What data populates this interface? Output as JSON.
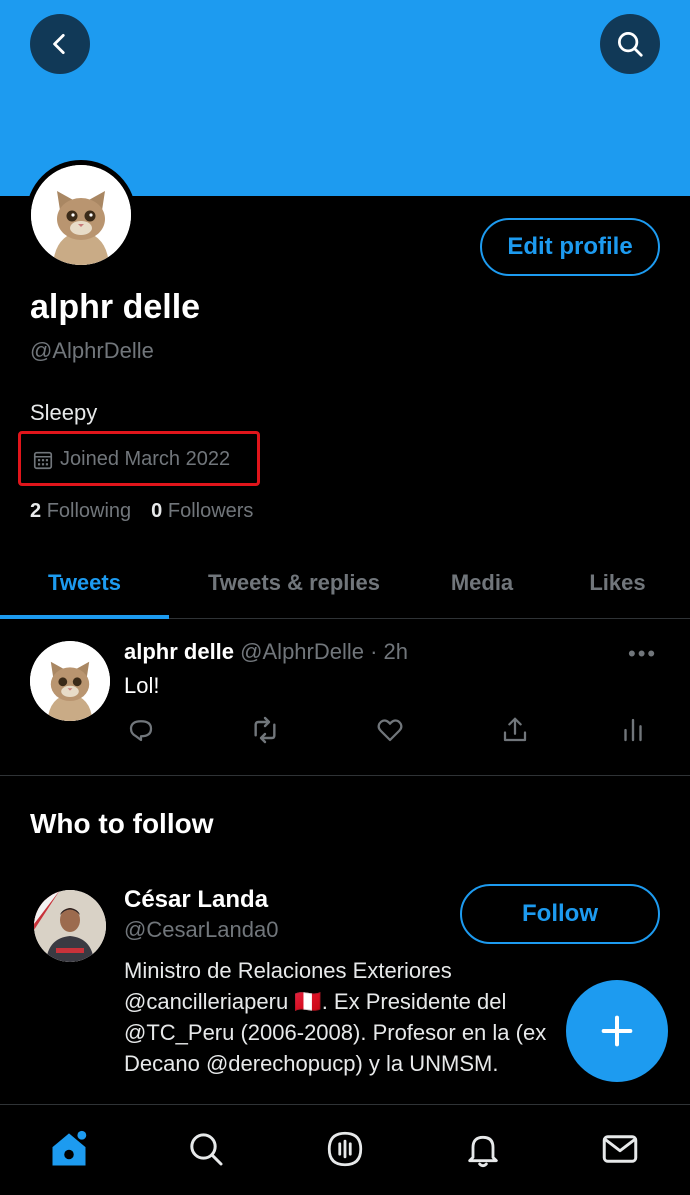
{
  "profile": {
    "name": "alphr delle",
    "handle": "@AlphrDelle",
    "bio": "Sleepy",
    "joined": "Joined March 2022",
    "following_count": "2",
    "following_label": "Following",
    "followers_count": "0",
    "followers_label": "Followers",
    "edit_label": "Edit profile"
  },
  "tabs": [
    {
      "label": "Tweets",
      "active": true
    },
    {
      "label": "Tweets & replies",
      "active": false
    },
    {
      "label": "Media",
      "active": false
    },
    {
      "label": "Likes",
      "active": false
    }
  ],
  "tweet": {
    "author": "alphr delle",
    "meta": "@AlphrDelle · 2h",
    "text": "Lol!",
    "more": "•••"
  },
  "who_to_follow": {
    "title": "Who to follow",
    "name": "César Landa",
    "handle": "@CesarLanda0",
    "follow_label": "Follow",
    "bio": "Ministro de Relaciones Exteriores @cancilleriaperu 🇵🇪. Ex Presidente del @TC_Peru (2006-2008). Profesor en la (ex Decano @derechopucp) y la UNMSM."
  },
  "icons": {
    "back": "back-arrow-icon",
    "search": "search-icon",
    "calendar": "calendar-icon",
    "reply": "reply-icon",
    "retweet": "retweet-icon",
    "like": "heart-icon",
    "share": "share-icon",
    "analytics": "analytics-icon",
    "compose": "plus-icon",
    "nav": [
      "home-icon",
      "search-icon",
      "spaces-icon",
      "bell-icon",
      "mail-icon"
    ]
  },
  "colors": {
    "accent": "#1d9bf0",
    "highlight": "#e0151b",
    "background": "#000000",
    "muted": "#71767b"
  }
}
